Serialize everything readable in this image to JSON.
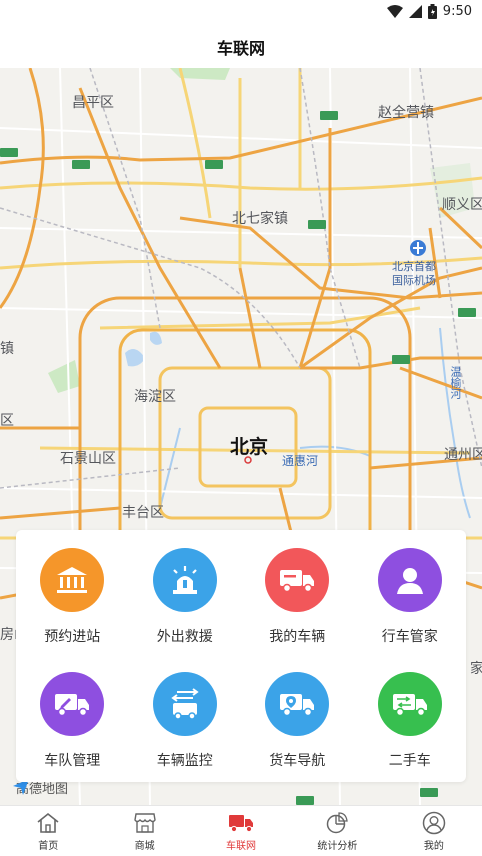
{
  "status": {
    "time": "9:50"
  },
  "header": {
    "title": "车联网"
  },
  "map": {
    "labels": {
      "changping": "昌平区",
      "zhaoquanying": "赵全营镇",
      "beiqijia": "北七家镇",
      "shunyi": "顺义区",
      "airport_line1": "北京首都",
      "airport_line2": "国际机场",
      "haidian": "海淀区",
      "beijing": "北京",
      "tonghui": "通惠河",
      "shijingshan": "石景山区",
      "fengtai": "丰台区",
      "tongzhou": "通州区",
      "wenyu": "温榆河",
      "zhen_left": "镇",
      "qu_left": "区",
      "fang_left": "房山",
      "jia_right": "家"
    },
    "logo": "高德地图"
  },
  "services": [
    {
      "label": "预约进站",
      "color": "#f5962a",
      "icon": "bank-icon"
    },
    {
      "label": "外出救援",
      "color": "#3ba3e8",
      "icon": "rescue-light-icon"
    },
    {
      "label": "我的车辆",
      "color": "#f2575a",
      "icon": "truck-icon"
    },
    {
      "label": "行车管家",
      "color": "#8e4fe0",
      "icon": "person-icon"
    },
    {
      "label": "车队管理",
      "color": "#8e4fe0",
      "icon": "fleet-edit-icon"
    },
    {
      "label": "车辆监控",
      "color": "#3ba3e8",
      "icon": "monitor-arrows-icon"
    },
    {
      "label": "货车导航",
      "color": "#3ba3e8",
      "icon": "navigation-truck-icon"
    },
    {
      "label": "二手车",
      "color": "#37bf4f",
      "icon": "trade-truck-icon"
    }
  ],
  "nav": [
    {
      "label": "首页",
      "icon": "home-icon"
    },
    {
      "label": "商城",
      "icon": "store-icon"
    },
    {
      "label": "车联网",
      "icon": "truck-nav-icon",
      "active": true
    },
    {
      "label": "统计分析",
      "icon": "pie-chart-icon"
    },
    {
      "label": "我的",
      "icon": "profile-icon"
    }
  ]
}
